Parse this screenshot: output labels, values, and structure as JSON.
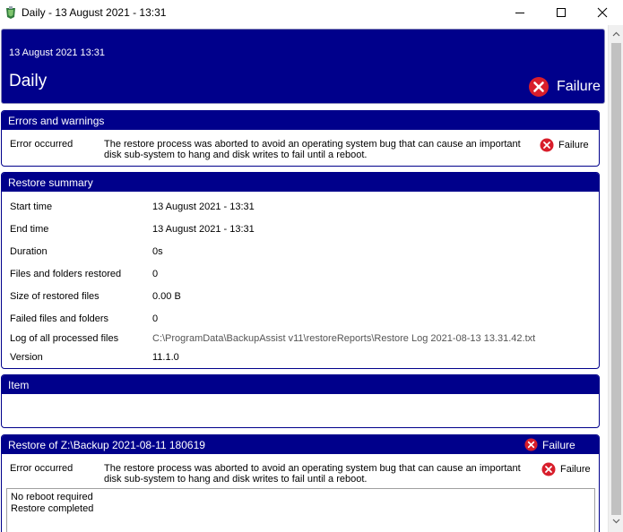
{
  "window": {
    "title": "Daily - 13 August 2021 - 13:31"
  },
  "header": {
    "date": "13 August 2021 13:31",
    "title": "Daily",
    "status": "Failure"
  },
  "errors": {
    "heading": "Errors and warnings",
    "rows": [
      {
        "label": "Error occurred",
        "message": "The restore process was aborted to avoid an operating system bug that can cause an important disk sub-system to hang and disk writes to fail until a reboot.",
        "status": "Failure"
      }
    ]
  },
  "summary": {
    "heading": "Restore summary",
    "rows": [
      {
        "label": "Start time",
        "value": "13 August 2021 - 13:31"
      },
      {
        "label": "End time",
        "value": "13 August 2021 - 13:31"
      },
      {
        "label": "Duration",
        "value": "0s"
      },
      {
        "label": "Files and folders restored",
        "value": "0"
      },
      {
        "label": "Size of restored files",
        "value": "0.00 B"
      },
      {
        "label": "Failed files and folders",
        "value": "0"
      },
      {
        "label": "Log of all processed files",
        "value": "C:\\ProgramData\\BackupAssist v11\\restoreReports\\Restore Log 2021-08-13 13.31.42.txt"
      },
      {
        "label": "Version",
        "value": "11.1.0"
      }
    ]
  },
  "item": {
    "heading": "Item"
  },
  "restore": {
    "heading": "Restore of Z:\\Backup 2021-08-11 180619",
    "status": "Failure",
    "rows": [
      {
        "label": "Error occurred",
        "message": "The restore process was aborted to avoid an operating system bug that can cause an important disk sub-system to hang and disk writes to fail until a reboot.",
        "status": "Failure"
      }
    ],
    "log_lines": [
      "No reboot required",
      "Restore completed"
    ]
  },
  "colors": {
    "header_bg": "#00008b",
    "failure_icon": "#d81e2b"
  },
  "icons": {
    "app": "backup-assist-app-icon",
    "failure": "failure-x-circle-icon"
  }
}
